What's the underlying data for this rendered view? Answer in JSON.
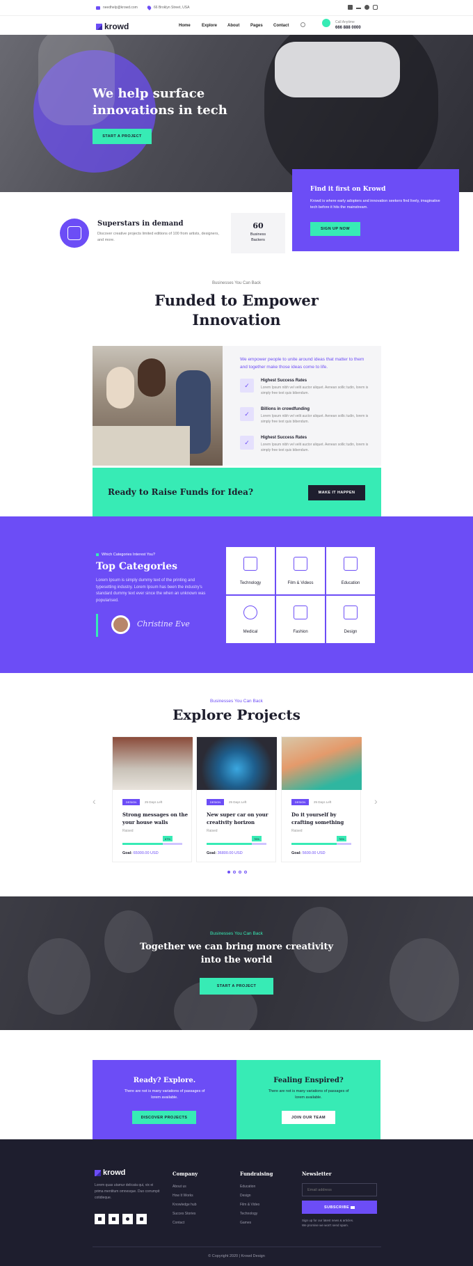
{
  "topbar": {
    "email": "needhelp@krowd.com",
    "address": "66 Broklyn Street, USA"
  },
  "header": {
    "brand": "krowd",
    "nav": [
      "Home",
      "Explore",
      "About",
      "Pages",
      "Contact"
    ],
    "call_label": "Call Anytime",
    "phone": "666 888 0000"
  },
  "hero": {
    "title_line1": "We help surface",
    "title_line2": "innovations in tech",
    "button": "START A PROJECT"
  },
  "find_box": {
    "title": "Find it first on Krowd",
    "text": "Krowd is where early adopters and innovation seekers find lively, imaginative tech before it hits the mainstream.",
    "button": "SIGN UP NOW"
  },
  "superstars": {
    "title": "Superstars in demand",
    "text": "Discover creative projects limited editions of 100 from artists, designers, and more."
  },
  "backers": {
    "count": "60",
    "label1": "Business",
    "label2": "Backers"
  },
  "funded": {
    "eyebrow": "Businesses You Can Back",
    "title_line1": "Funded to Empower",
    "title_line2": "Innovation",
    "intro": "We empower people to unite around ideas that matter to them and together make those ideas come to life.",
    "features": [
      {
        "title": "Highest Success Rates",
        "text": "Lorem Ipsum nibh vel velit auctor aliquet. Aenean sollic tudin, lorem is simply free text quis bibendum."
      },
      {
        "title": "Billions in crowdfunding",
        "text": "Lorem Ipsum nibh vel velit auctor aliquet. Aenean sollic tudin, lorem is simply free text quis bibendum."
      },
      {
        "title": "Highest Success Rates",
        "text": "Lorem Ipsum nibh vel velit auctor aliquet. Aenean sollic tudin, lorem is simply free text quis bibendum."
      }
    ]
  },
  "raise": {
    "title": "Ready to Raise Funds for Idea?",
    "button": "MAKE IT HAPPEN"
  },
  "categories": {
    "eyebrow": "Which Categories Interest You?",
    "title": "Top Categories",
    "text": "Lorem Ipsum is simply dummy text of the printing and typesetting industry. Lorem Ipsum has been the industry's standard dummy text ever since the when an unknown was popularised.",
    "signature": "Christine Eve",
    "items": [
      "Technology",
      "Film & Videos",
      "Education",
      "Medical",
      "Fashion",
      "Design"
    ]
  },
  "projects": {
    "eyebrow": "Businesses You Can Back",
    "title": "Explore Projects",
    "raised_label": "Raised",
    "goal_label": "Goal:",
    "cards": [
      {
        "tag": "DESIGN",
        "days": "25 Days Left",
        "title": "Strong messages on the your house walls",
        "percent": 67,
        "percent_label": "67%",
        "goal": "65000.00 USD"
      },
      {
        "tag": "DESIGN",
        "days": "25 Days Left",
        "title": "New super car on your creativity horizon",
        "percent": 76,
        "percent_label": "76%",
        "goal": "36800.00 USD"
      },
      {
        "tag": "DESIGN",
        "days": "25 Days Left",
        "title": "Do it yourself by crafting something",
        "percent": 76,
        "percent_label": "76%",
        "goal": "5600.00 USD"
      }
    ],
    "prev": "‹",
    "next": "›"
  },
  "together": {
    "eyebrow": "Businesses You Can Back",
    "title_line1": "Together we can bring more creativity",
    "title_line2": "into the world",
    "button": "START A PROJECT"
  },
  "cta": {
    "left": {
      "title": "Ready? Explore.",
      "text": "There are not is many variations of passages of lorem available.",
      "button": "DISCOVER PROJECTS"
    },
    "right": {
      "title": "Fealing Enspired?",
      "text": "There are not is many variations of passages of lorem available.",
      "button": "JOIN OUR TEAM"
    }
  },
  "footer": {
    "brand": "krowd",
    "about": "Lorem quas utamur delicata qui, vix ei prima mentitum omnesque. Duo corrumpit cotidieque.",
    "company_title": "Company",
    "company_links": [
      "About us",
      "How It Works",
      "Knowledge hub",
      "Succes Stories",
      "Contact"
    ],
    "fund_title": "Fundraising",
    "fund_links": [
      "Education",
      "Design",
      "Film & Video",
      "Technology",
      "Games"
    ],
    "news_title": "Newsletter",
    "email_placeholder": "Email address",
    "subscribe": "SUBSCRIBE",
    "news_note1": "Sign up for our latest news & articles.",
    "news_note2": "We promise we won't send spam.",
    "copyright": "© Copyright 2020 | Krowd Design"
  },
  "colors": {
    "accent": "#6c4df6",
    "mint": "#37ebb5",
    "dark": "#1e1e2e"
  }
}
